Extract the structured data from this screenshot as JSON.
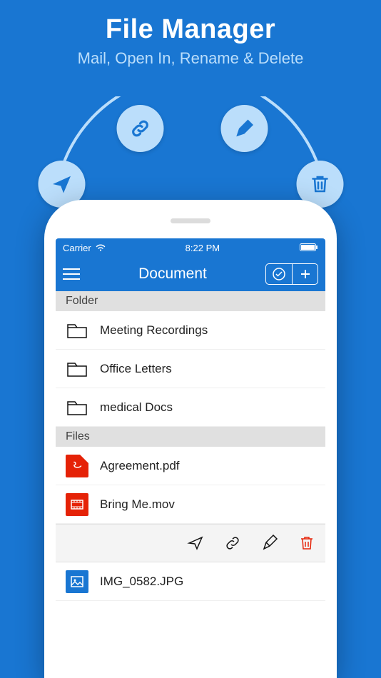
{
  "promo": {
    "title": "File Manager",
    "subtitle": "Mail, Open In, Rename & Delete"
  },
  "bubbles": [
    {
      "name": "send-icon"
    },
    {
      "name": "link-icon"
    },
    {
      "name": "pen-icon"
    },
    {
      "name": "trash-icon"
    }
  ],
  "status": {
    "carrier": "Carrier",
    "time": "8:22 PM"
  },
  "nav": {
    "title": "Document"
  },
  "sections": {
    "folder_label": "Folder",
    "files_label": "Files"
  },
  "folders": [
    {
      "name": "Meeting Recordings"
    },
    {
      "name": "Office Letters"
    },
    {
      "name": "medical Docs"
    }
  ],
  "files": [
    {
      "name": "Agreement.pdf",
      "type": "pdf"
    },
    {
      "name": "Bring Me.mov",
      "type": "mov"
    },
    {
      "name": "IMG_0582.JPG",
      "type": "jpg"
    }
  ],
  "swipe_actions": [
    {
      "name": "send-action"
    },
    {
      "name": "link-action"
    },
    {
      "name": "rename-action"
    },
    {
      "name": "delete-action"
    }
  ],
  "colors": {
    "primary": "#1976D2",
    "bubble": "#BBDEFB",
    "danger": "#E52207"
  }
}
